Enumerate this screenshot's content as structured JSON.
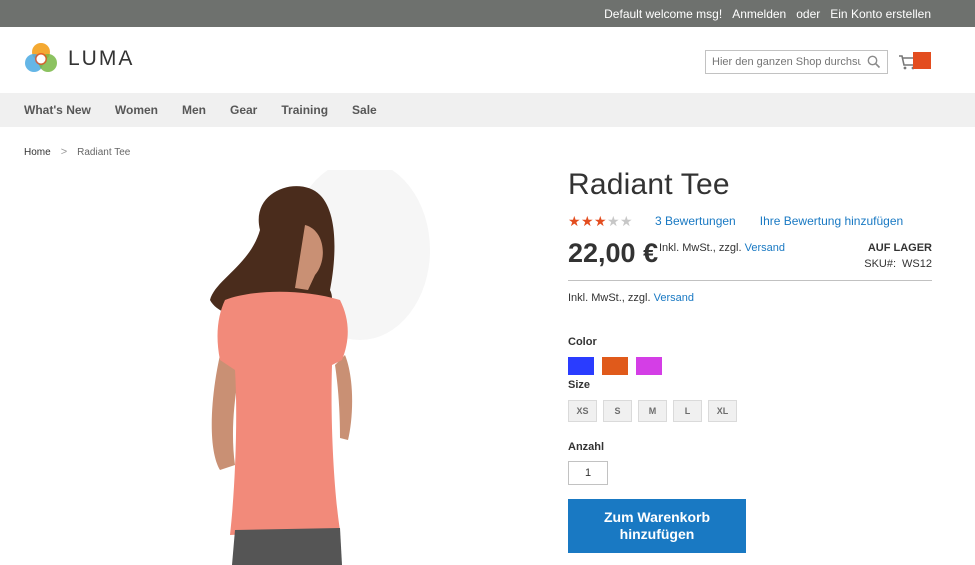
{
  "topbar": {
    "welcome": "Default welcome msg!",
    "sign_in": "Anmelden",
    "or": "oder",
    "create_account": "Ein Konto erstellen"
  },
  "header": {
    "logo_text": "LUMA",
    "search_placeholder": "Hier den ganzen Shop durchsuchen",
    "search_icon": "search-icon",
    "cart_icon": "cart-icon"
  },
  "nav": {
    "items": [
      "What's New",
      "Women",
      "Men",
      "Gear",
      "Training",
      "Sale"
    ]
  },
  "breadcrumb": {
    "home": "Home",
    "separator": ">",
    "current": "Radiant Tee"
  },
  "product": {
    "title": "Radiant Tee",
    "rating_stars": 3,
    "rating_max": 5,
    "reviews_link": "3 Bewertungen",
    "add_review_link": "Ihre Bewertung hinzufügen",
    "price": "22,00 €",
    "tax_text": "Inkl. MwSt., zzgl.",
    "shipping_link": "Versand",
    "stock": "AUF LAGER",
    "sku_label": "SKU#:",
    "sku_value": "WS12",
    "tax_text_2": "Inkl. MwSt., zzgl.",
    "shipping_link_2": "Versand",
    "color_label": "Color",
    "colors": [
      "#2a3cff",
      "#e05a1b",
      "#d43ee6"
    ],
    "size_label": "Size",
    "sizes": [
      "XS",
      "S",
      "M",
      "L",
      "XL"
    ],
    "qty_label": "Anzahl",
    "qty_value": "1",
    "add_to_cart": "Zum Warenkorb hinzufügen"
  },
  "colors": {
    "topbar_bg": "#6e716e",
    "accent_link": "#1979c3",
    "button_bg": "#1979c3",
    "star_active": "#e34d1f",
    "cart_badge": "#e34d1f"
  }
}
